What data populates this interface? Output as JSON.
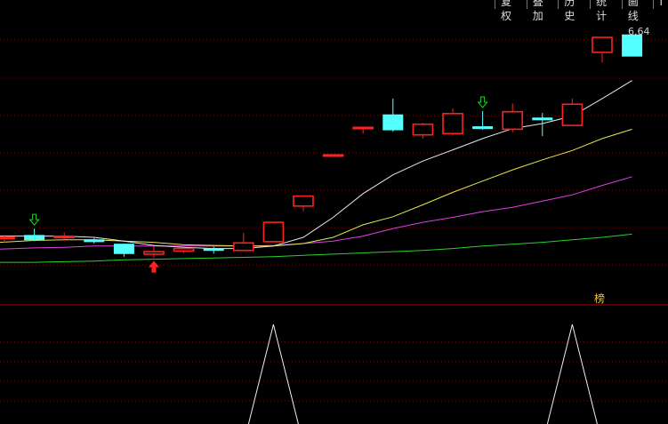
{
  "toolbar": {
    "buttons": [
      "复权",
      "叠加",
      "历史",
      "统计",
      "画线"
    ],
    "overflow": "I"
  },
  "price_label": "6.64",
  "signal_char": "榜",
  "colors": {
    "background": "#000000",
    "up": "#ff2020",
    "down": "#54ffff",
    "ma_white": "#e8e8e8",
    "ma_yellow": "#e6e64a",
    "ma_magenta": "#e040e0",
    "ma_green": "#29d129",
    "grid": "#8b0000",
    "separator": "#b00000"
  },
  "chart_data": [
    {
      "type": "candlestick",
      "panel": "price",
      "ylim": [
        4.6,
        6.72
      ],
      "candles": [
        {
          "o": 5.015,
          "h": 5.04,
          "l": 4.978,
          "c": 5.02
        },
        {
          "o": 5.035,
          "h": 5.09,
          "l": 4.99,
          "c": 5.0
        },
        {
          "o": 5.02,
          "h": 5.06,
          "l": 4.99,
          "c": 5.028
        },
        {
          "o": 5.0,
          "h": 5.014,
          "l": 4.97,
          "c": 4.985
        },
        {
          "o": 4.965,
          "h": 4.965,
          "l": 4.865,
          "c": 4.89
        },
        {
          "o": 4.885,
          "h": 4.95,
          "l": 4.855,
          "c": 4.905
        },
        {
          "o": 4.91,
          "h": 4.93,
          "l": 4.895,
          "c": 4.93
        },
        {
          "o": 4.93,
          "h": 4.945,
          "l": 4.89,
          "c": 4.915
        },
        {
          "o": 4.915,
          "h": 5.055,
          "l": 4.908,
          "c": 4.975
        },
        {
          "o": 4.985,
          "h": 5.14,
          "l": 4.985,
          "c": 5.14
        },
        {
          "o": 5.27,
          "h": 5.35,
          "l": 5.23,
          "c": 5.35
        },
        {
          "o": 5.68,
          "h": 5.68,
          "l": 5.68,
          "c": 5.68
        },
        {
          "o": 5.9,
          "h": 5.9,
          "l": 5.85,
          "c": 5.9
        },
        {
          "o": 6.0,
          "h": 6.13,
          "l": 5.865,
          "c": 5.88
        },
        {
          "o": 5.84,
          "h": 5.937,
          "l": 5.81,
          "c": 5.925
        },
        {
          "o": 5.85,
          "h": 6.05,
          "l": 5.835,
          "c": 6.01
        },
        {
          "o": 5.905,
          "h": 6.03,
          "l": 5.88,
          "c": 5.89
        },
        {
          "o": 5.885,
          "h": 6.09,
          "l": 5.86,
          "c": 6.025
        },
        {
          "o": 5.975,
          "h": 6.015,
          "l": 5.83,
          "c": 5.96
        },
        {
          "o": 5.915,
          "h": 6.13,
          "l": 5.915,
          "c": 6.085
        },
        {
          "o": 6.5,
          "h": 6.62,
          "l": 6.42,
          "c": 6.62
        },
        {
          "o": 6.64,
          "h": 6.64,
          "l": 6.47,
          "c": 6.47
        }
      ],
      "ma_series": [
        {
          "color": "white",
          "values": [
            5.03,
            5.03,
            5.03,
            5.02,
            4.99,
            4.955,
            4.94,
            4.93,
            4.93,
            4.95,
            5.02,
            5.18,
            5.37,
            5.52,
            5.63,
            5.72,
            5.81,
            5.89,
            5.93,
            5.99,
            6.13,
            6.275
          ]
        },
        {
          "color": "yellow",
          "values": [
            4.98,
            4.995,
            5.0,
            5.0,
            4.99,
            4.98,
            4.96,
            4.955,
            4.95,
            4.95,
            4.97,
            5.02,
            5.12,
            5.185,
            5.28,
            5.38,
            5.47,
            5.56,
            5.64,
            5.715,
            5.81,
            5.885
          ]
        },
        {
          "color": "magenta",
          "values": [
            4.925,
            4.935,
            4.94,
            4.95,
            4.95,
            4.95,
            4.95,
            4.95,
            4.95,
            4.955,
            4.97,
            4.99,
            5.03,
            5.09,
            5.14,
            5.18,
            5.225,
            5.26,
            5.31,
            5.36,
            5.435,
            5.505
          ]
        },
        {
          "color": "green",
          "values": [
            4.82,
            4.82,
            4.825,
            4.83,
            4.84,
            4.845,
            4.85,
            4.855,
            4.86,
            4.865,
            4.875,
            4.885,
            4.895,
            4.905,
            4.915,
            4.93,
            4.95,
            4.965,
            4.98,
            5.0,
            5.02,
            5.045
          ]
        }
      ],
      "signals": [
        {
          "index": 1,
          "kind": "green-down-arrow"
        },
        {
          "index": 5,
          "kind": "red-up-arrow"
        },
        {
          "index": 16,
          "kind": "green-down-arrow"
        }
      ]
    },
    {
      "type": "line",
      "panel": "indicator",
      "ylim": [
        0,
        1
      ],
      "values": [
        0,
        0,
        0,
        0,
        0,
        0,
        0,
        0,
        0,
        1,
        0,
        0,
        0,
        0,
        0,
        0,
        0,
        0,
        0,
        1,
        0,
        0
      ]
    }
  ]
}
